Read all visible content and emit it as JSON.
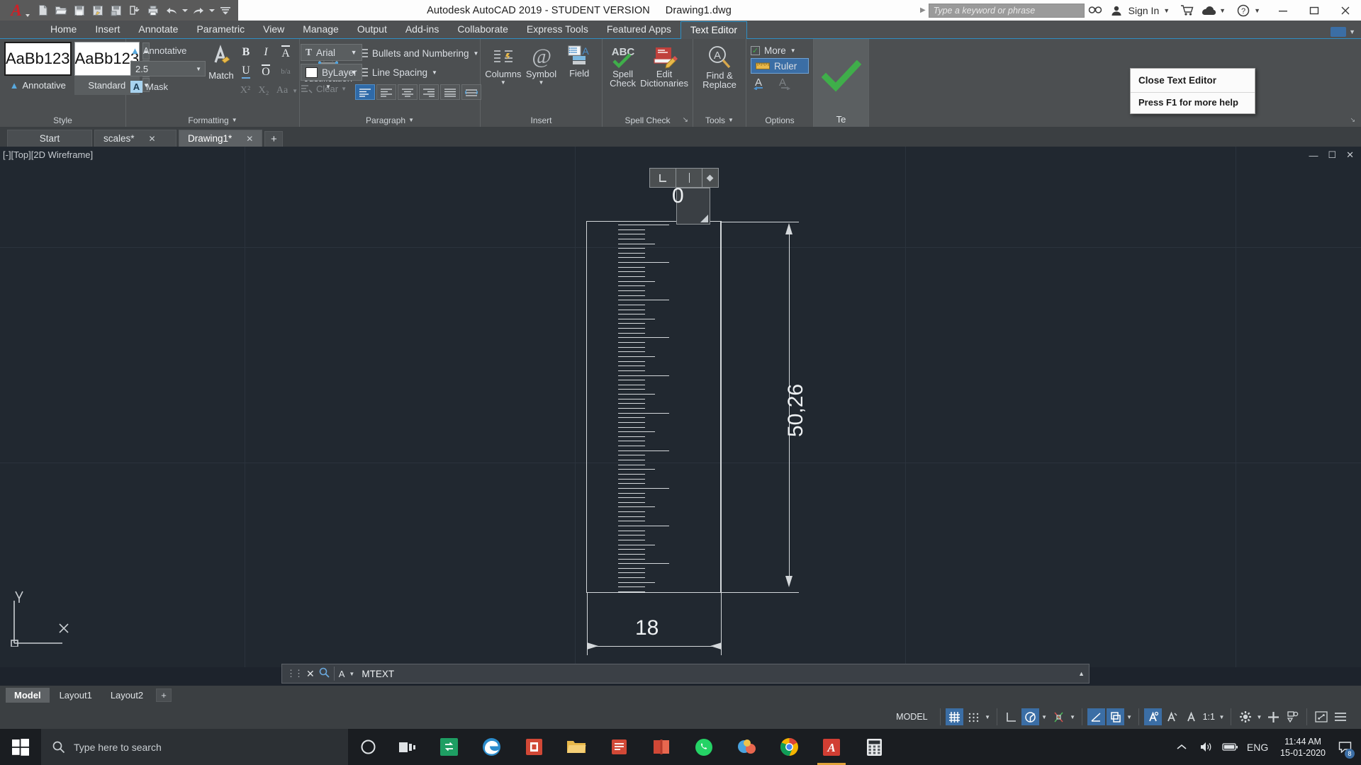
{
  "titlebar": {
    "app_title": "Autodesk AutoCAD 2019 - STUDENT VERSION",
    "file_name": "Drawing1.dwg",
    "search_placeholder": "Type a keyword or phrase",
    "sign_in": "Sign In",
    "quick_access": [
      "new-icon",
      "open-icon",
      "save-icon",
      "save-as-icon",
      "plot-preview-icon",
      "cloud-sync-icon",
      "plot-icon",
      "undo-icon",
      "redo-icon",
      "customize-icon"
    ],
    "window_buttons": [
      "minimize",
      "maximize",
      "close"
    ]
  },
  "ribbon_tabs": {
    "items": [
      "Home",
      "Insert",
      "Annotate",
      "Parametric",
      "View",
      "Manage",
      "Output",
      "Add-ins",
      "Collaborate",
      "Express Tools",
      "Featured Apps",
      "Text Editor"
    ],
    "active": "Text Editor"
  },
  "ribbon": {
    "style_panel": {
      "title": "Style",
      "swatch_text": "AaBb123",
      "styles": [
        {
          "label": "Annotative",
          "selected": true
        },
        {
          "label": "Standard",
          "selected": false
        }
      ],
      "annotative_label": "Annotative",
      "text_height": "2.5",
      "mask_label": "Mask"
    },
    "formatting_panel": {
      "title": "Formatting",
      "match_label": "Match",
      "buttons": [
        "B",
        "I",
        "A",
        "U",
        "O",
        "b/a"
      ],
      "sub_buttons": [
        "X²",
        "X₂",
        "Aa"
      ],
      "clear_label": "Clear",
      "font": "Arial",
      "color": "ByLayer"
    },
    "paragraph_panel": {
      "title": "Paragraph",
      "justification_label": "Justification",
      "bullets_label": "Bullets and Numbering",
      "line_spacing_label": "Line Spacing",
      "align_buttons": [
        "align-default",
        "align-left",
        "align-center",
        "align-right",
        "align-justify",
        "align-distributed"
      ],
      "align_active": 0
    },
    "insert_panel": {
      "title": "Insert",
      "items": [
        {
          "label": "Columns",
          "icon": "columns-icon",
          "has_caret": true
        },
        {
          "label": "Symbol",
          "icon": "at-symbol-icon",
          "has_caret": true
        },
        {
          "label": "Field",
          "icon": "field-icon",
          "has_caret": false
        }
      ]
    },
    "spell_panel": {
      "title": "Spell Check",
      "items": [
        {
          "label_line1": "Spell",
          "label_line2": "Check",
          "icon": "abc-check-icon"
        },
        {
          "label_line1": "Edit",
          "label_line2": "Dictionaries",
          "icon": "dictionary-book-icon"
        }
      ]
    },
    "tools_panel": {
      "title": "Tools",
      "items": [
        {
          "label_line1": "Find &",
          "label_line2": "Replace",
          "icon": "find-replace-icon"
        }
      ]
    },
    "options_panel": {
      "title": "Options",
      "more_label": "More",
      "more_checked": true,
      "ruler_label": "Ruler",
      "ruler_active": true,
      "undo_label": "undo-text-icon",
      "redo_label": "redo-text-icon"
    },
    "close_panel": {
      "label": "Close Text Editor",
      "icon": "green-check-icon"
    }
  },
  "tooltip": {
    "title": "Close Text Editor",
    "help": "Press F1 for more help"
  },
  "doc_tabs": {
    "items": [
      {
        "label": "Start",
        "closable": false,
        "active": false
      },
      {
        "label": "scales*",
        "closable": true,
        "active": false
      },
      {
        "label": "Drawing1*",
        "closable": true,
        "active": true
      }
    ],
    "new_tab": "+"
  },
  "viewport": {
    "label": "[-][Top][2D Wireframe]",
    "controls": [
      "minimize-icon",
      "restore-icon",
      "close-icon"
    ]
  },
  "drawing": {
    "dim_vertical": "50,26",
    "dim_horizontal": "18",
    "mtext_value": "0",
    "ucs_x": "X",
    "ucs_y": "Y"
  },
  "command_line": {
    "prompt": "MTEXT",
    "close_icon": "close-icon",
    "search_icon": "search-icon",
    "menu_icon": "A-menu-icon"
  },
  "layout_tabs": {
    "items": [
      {
        "label": "Model",
        "active": true
      },
      {
        "label": "Layout1",
        "active": false
      },
      {
        "label": "Layout2",
        "active": false
      }
    ],
    "add": "+"
  },
  "status_bar": {
    "space_label": "MODEL",
    "scale": "1:1",
    "toggles": [
      {
        "name": "grid-display",
        "on": true
      },
      {
        "name": "snap-mode",
        "on": false
      },
      {
        "name": "ortho-mode",
        "on": false
      },
      {
        "name": "polar-tracking",
        "on": true
      },
      {
        "name": "isometric-drafting",
        "on": false
      },
      {
        "name": "object-snap-tracking",
        "on": false
      },
      {
        "name": "object-snap",
        "on": true
      },
      {
        "name": "lineweight",
        "on": false
      },
      {
        "name": "transparency",
        "on": false
      },
      {
        "name": "annotation-visibility",
        "on": true
      },
      {
        "name": "autoscale",
        "on": false
      },
      {
        "name": "annotation-scale",
        "on": false
      },
      {
        "name": "workspace-settings",
        "on": false
      },
      {
        "name": "hardware-acceleration",
        "on": false
      },
      {
        "name": "isolate-objects",
        "on": false
      },
      {
        "name": "fullscreen",
        "on": false
      },
      {
        "name": "customization",
        "on": false
      }
    ]
  },
  "taskbar": {
    "search_placeholder": "Type here to search",
    "apps": [
      "cortana-icon",
      "task-view-icon",
      "app-switch-icon",
      "edge-icon",
      "store-icon",
      "file-explorer-icon",
      "sticky-icon",
      "book-icon",
      "whatsapp-icon",
      "paint3d-icon",
      "chrome-icon",
      "autocad-icon",
      "calculator-icon"
    ],
    "tray": [
      "show-hidden-icon",
      "volume-icon",
      "battery-icon"
    ],
    "language": "ENG",
    "time": "11:44 AM",
    "date": "15-01-2020",
    "notification_count": "8"
  },
  "colors": {
    "canvas_bg": "#212830",
    "ribbon_bg": "#4c4f51",
    "accent_blue": "#3b6ea5",
    "tab_underline": "#2e8fc4",
    "geometry": "#d4d8db",
    "green_check": "#3fae4a"
  }
}
